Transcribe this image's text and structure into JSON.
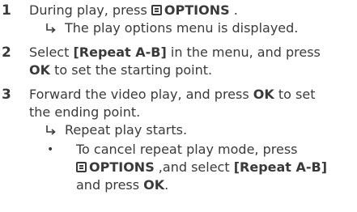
{
  "steps": [
    {
      "number": "1",
      "line1_pre": "During play, press ",
      "line1_options": "OPTIONS",
      "line1_post": " .",
      "result": "The play options menu is displayed."
    },
    {
      "number": "2",
      "line1_pre": "Select ",
      "line1_item": "[Repeat A-B]",
      "line1_post": " in the menu, and press",
      "line2_ok": "OK",
      "line2_post": " to set the starting point."
    },
    {
      "number": "3",
      "line1_pre": "Forward the video play, and press ",
      "line1_ok": "OK",
      "line1_post": " to set",
      "line2": "the ending point.",
      "result": "Repeat play starts.",
      "bullet": {
        "symbol": "•",
        "line1": "To cancel repeat play mode, press",
        "line2_options": "OPTIONS",
        "line2_mid": " ,and select ",
        "line2_item": "[Repeat A-B]",
        "line3_pre": "and press ",
        "line3_ok": "OK",
        "line3_post": "."
      }
    }
  ],
  "icons": {
    "result_arrow": "arrow-right-hook-icon",
    "options_button": "options-menu-icon"
  },
  "colors": {
    "text": "#3a3a3a"
  }
}
